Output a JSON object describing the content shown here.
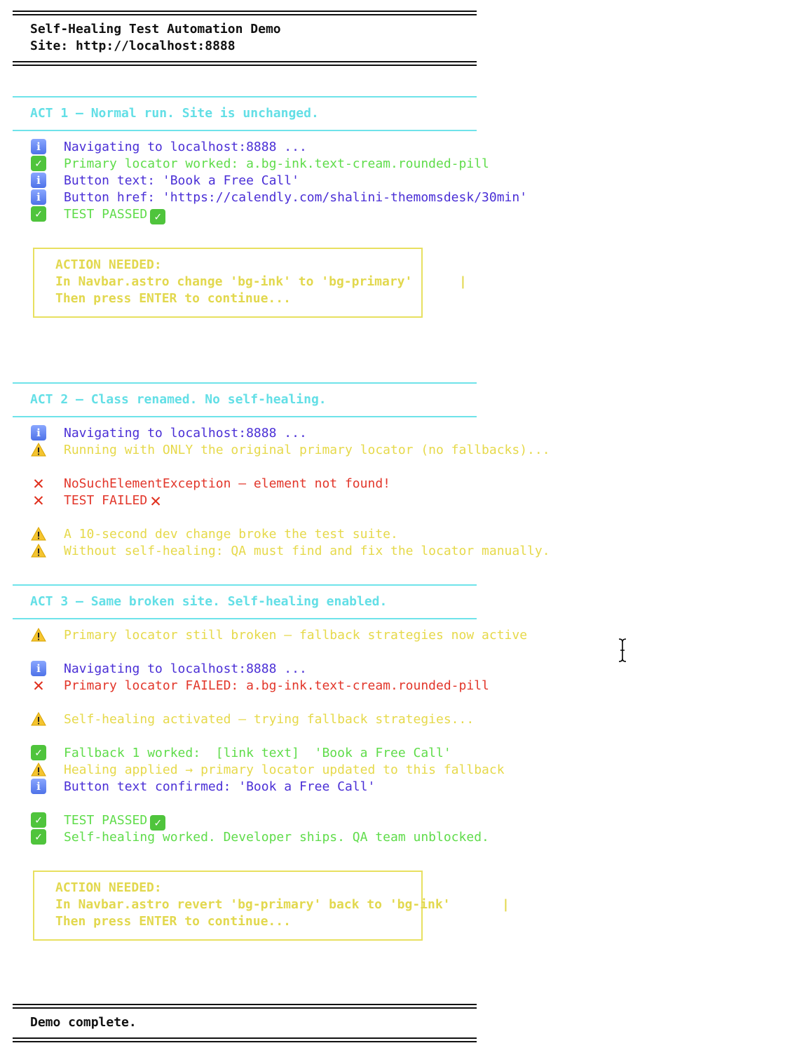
{
  "header": {
    "title": "Self-Healing Test Automation Demo",
    "site": "Site: http://localhost:8888"
  },
  "acts": [
    {
      "title": "ACT 1 — Normal run. Site is unchanged.",
      "lines": [
        {
          "type": "info",
          "text": "Navigating to localhost:8888 ..."
        },
        {
          "type": "pass",
          "text": "Primary locator worked: a.bg-ink.text-cream.rounded-pill"
        },
        {
          "type": "info",
          "text": "Button text: 'Book a Free Call'"
        },
        {
          "type": "info",
          "text": "Button href: 'https://calendly.com/shalini-themomsdesk/30min'"
        },
        {
          "type": "pass",
          "text": "TEST PASSED"
        }
      ],
      "action": {
        "heading": "ACTION NEEDED:",
        "instruction": "In Navbar.astro change 'bg-ink' to 'bg-primary'",
        "prompt": "Then press ENTER to continue..."
      }
    },
    {
      "title": "ACT 2 — Class renamed. No self-healing.",
      "lines": [
        {
          "type": "info",
          "text": "Navigating to localhost:8888 ..."
        },
        {
          "type": "warn",
          "text": "Running with ONLY the original primary locator (no fallbacks)..."
        },
        {
          "type": "fail",
          "text": "NoSuchElementException — element not found!"
        },
        {
          "type": "fail",
          "text": "TEST FAILED"
        },
        {
          "type": "warn",
          "text": "A 10-second dev change broke the test suite."
        },
        {
          "type": "warn",
          "text": "Without self-healing: QA must find and fix the locator manually."
        }
      ]
    },
    {
      "title": "ACT 3 — Same broken site. Self-healing enabled.",
      "lines": [
        {
          "type": "warn",
          "text": "Primary locator still broken — fallback strategies now active"
        },
        {
          "type": "info",
          "text": "Navigating to localhost:8888 ..."
        },
        {
          "type": "fail",
          "text": "Primary locator FAILED: a.bg-ink.text-cream.rounded-pill"
        },
        {
          "type": "warn",
          "text": "Self-healing activated — trying fallback strategies..."
        },
        {
          "type": "pass",
          "text": "Fallback 1 worked:  [link text]  'Book a Free Call'"
        },
        {
          "type": "warn",
          "text": "Healing applied → primary locator updated to this fallback"
        },
        {
          "type": "info",
          "text": "Button text confirmed: 'Book a Free Call'"
        },
        {
          "type": "pass",
          "text": "TEST PASSED"
        },
        {
          "type": "pass",
          "text": "Self-healing worked. Developer ships. QA team unblocked."
        }
      ],
      "action": {
        "heading": "ACTION NEEDED:",
        "instruction": "In Navbar.astro revert 'bg-primary' back to 'bg-ink'",
        "prompt": "Then press ENTER to continue..."
      }
    }
  ],
  "footer": {
    "message": "Demo complete."
  },
  "icons": {
    "info": "info-icon",
    "pass": "check-icon",
    "warn": "warning-icon",
    "fail": "cross-icon"
  },
  "colors": {
    "info": "#4a2fd6",
    "pass": "#5fdc4a",
    "warn": "#e6d94a",
    "fail": "#e2362a",
    "act_title": "#63dfe6",
    "action": "#e2d84e"
  }
}
